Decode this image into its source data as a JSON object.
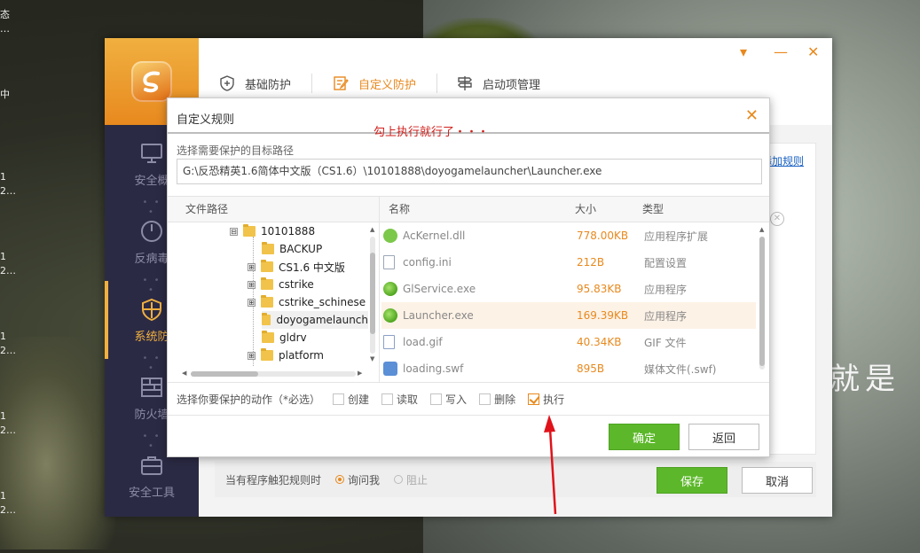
{
  "desktop": {
    "labels": [
      "态",
      "…",
      "中",
      "1",
      "2…",
      "1",
      "2…",
      "1",
      "2…",
      "1",
      "2…",
      "1",
      "2…"
    ],
    "bg_text": "就是"
  },
  "app": {
    "tabs": [
      {
        "label": "基础防护",
        "icon": "shield-plus-icon"
      },
      {
        "label": "自定义防护",
        "icon": "edit-note-icon"
      },
      {
        "label": "启动项管理",
        "icon": "startup-sign-icon"
      }
    ],
    "window_controls": {
      "menu": "▾",
      "minimize": "—",
      "close": "✕"
    },
    "sidebar": {
      "items": [
        {
          "label": "安全概",
          "icon": "monitor-icon"
        },
        {
          "label": "反病毒",
          "icon": "gauge-icon"
        },
        {
          "label": "系统防",
          "icon": "shield-grid-icon"
        },
        {
          "label": "防火墙",
          "icon": "firewall-icon"
        },
        {
          "label": "安全工具",
          "icon": "toolbox-icon"
        }
      ]
    },
    "add_rule_link": "添加规则",
    "bottom_bar": {
      "prompt": "当有程序触犯规则时",
      "option_ask": "询问我",
      "option_block": "阻止",
      "save": "保存",
      "cancel": "取消"
    }
  },
  "dialog": {
    "title": "自定义规则",
    "annotation": "勾上执行就行了・・・",
    "path_label": "选择需要保护的目标路径",
    "path_value": "G:\\反恐精英1.6简体中文版（CS1.6）\\10101888\\doyogamelauncher\\Launcher.exe",
    "tree_header": "文件路径",
    "tree": [
      {
        "name": "10101888",
        "expander": "⊟",
        "level": 0
      },
      {
        "name": "BACKUP",
        "expander": "",
        "level": 1
      },
      {
        "name": "CS1.6 中文版",
        "expander": "⊞",
        "level": 1
      },
      {
        "name": "cstrike",
        "expander": "⊞",
        "level": 1
      },
      {
        "name": "cstrike_schinese",
        "expander": "⊞",
        "level": 1
      },
      {
        "name": "doyogamelaunch",
        "expander": "",
        "level": 1,
        "selected": true
      },
      {
        "name": "gldrv",
        "expander": "",
        "level": 1
      },
      {
        "name": "platform",
        "expander": "⊞",
        "level": 1
      }
    ],
    "columns": {
      "name": "名称",
      "size": "大小",
      "type": "类型"
    },
    "files": [
      {
        "name": "AcKernel.dll",
        "size": "778.00KB",
        "type": "应用程序扩展",
        "icon": "gear-green-icon",
        "color": "#7cc84a"
      },
      {
        "name": "config.ini",
        "size": "212B",
        "type": "配置设置",
        "icon": "ini-file-icon",
        "color": "#9aa6b8"
      },
      {
        "name": "GlService.exe",
        "size": "95.83KB",
        "type": "应用程序",
        "icon": "green-app-icon",
        "color": "#6cc12e"
      },
      {
        "name": "Launcher.exe",
        "size": "169.39KB",
        "type": "应用程序",
        "icon": "green-app-icon",
        "color": "#6cc12e"
      },
      {
        "name": "load.gif",
        "size": "40.34KB",
        "type": "GIF 文件",
        "icon": "image-file-icon",
        "color": "#8aa0c8"
      },
      {
        "name": "loading.swf",
        "size": "895B",
        "type": "媒体文件(.swf)",
        "icon": "media-file-icon",
        "color": "#5b8fd6"
      }
    ],
    "selected_file_index": 3,
    "actions_label": "选择你要保护的动作（*必选）",
    "actions": [
      {
        "label": "创建",
        "checked": false
      },
      {
        "label": "读取",
        "checked": false
      },
      {
        "label": "写入",
        "checked": false
      },
      {
        "label": "删除",
        "checked": false
      },
      {
        "label": "执行",
        "checked": true
      }
    ],
    "ok": "确定",
    "back": "返回"
  }
}
